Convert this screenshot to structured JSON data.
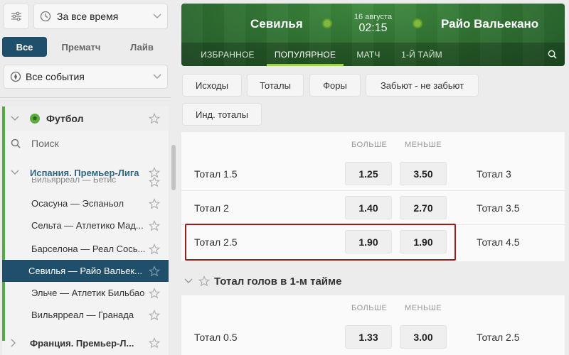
{
  "sidebar": {
    "time_filter": "За все время",
    "mode_tabs": [
      "Все",
      "Прематч",
      "Лайв"
    ],
    "events_filter": "Все события",
    "sport": "Футбол",
    "search_placeholder": "Поиск",
    "league": "Испания. Премьер-Лига",
    "cut_item": "Вильярреал — Бетис",
    "matches": [
      "Осасуна — Эспаньол",
      "Сельта — Атлетико Мад...",
      "Барселона — Реал Сось...",
      "Севилья — Райо Вальек...",
      "Эльче — Атлетик Бильбао",
      "Вильярреал — Гранада"
    ],
    "next_league": "Франция. Премьер-Л..."
  },
  "header": {
    "home_team": "Севилья",
    "away_team": "Райо Вальекано",
    "date": "16 августа",
    "time": "02:15",
    "tabs": [
      "ИЗБРАННОЕ",
      "ПОПУЛЯРНОЕ",
      "МАТЧ",
      "1-Й ТАЙМ"
    ]
  },
  "market_buttons": [
    "Исходы",
    "Тоталы",
    "Форы",
    "Забьют - не забьют",
    "Инд. тоталы"
  ],
  "odds_table": {
    "col_over": "БОЛЬШЕ",
    "col_under": "МЕНЬШЕ",
    "rows": [
      {
        "label": "Тотал 1.5",
        "over": "1.25",
        "under": "3.50",
        "next": "Тотал 3"
      },
      {
        "label": "Тотал 2",
        "over": "1.40",
        "under": "2.70",
        "next": "Тотал 3.5"
      },
      {
        "label": "Тотал 2.5",
        "over": "1.90",
        "under": "1.90",
        "next": "Тотал 4.5"
      }
    ]
  },
  "section2": {
    "title": "Тотал голов в 1-м тайме",
    "col_over": "БОЛЬШЕ",
    "col_under": "МЕНЬШЕ",
    "rows": [
      {
        "label": "Тотал 0.5",
        "over": "1.33",
        "under": "3.00",
        "next": "Тотал 2.5"
      }
    ]
  },
  "colors": {
    "accent_dark": "#1f4f6a",
    "header_green": "#2f6f31",
    "tab_underline": "#9cd049",
    "highlight": "#9a1c1c"
  }
}
